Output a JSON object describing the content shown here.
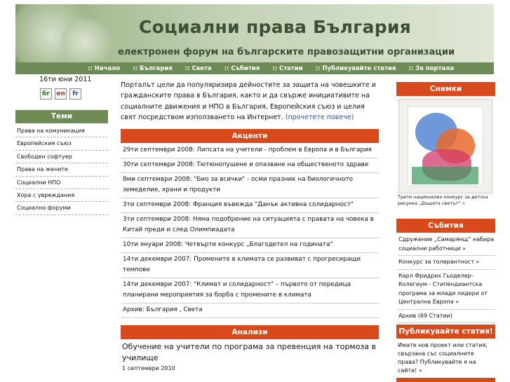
{
  "header": {
    "title": "Социални права България",
    "subtitle": "електронен форум на българските правозащитни организации"
  },
  "nav": [
    ":: Начало",
    ":: България",
    ":: Света",
    ":: Събития",
    ":: Статии",
    ":: Публикувайте статия",
    ":: За портала"
  ],
  "date": "16ти юни 2011",
  "languages": [
    "бг",
    "en",
    "fr"
  ],
  "topics": {
    "heading": "Теми",
    "items": [
      "Права на комуникация",
      "Европейския съюз",
      "Свободен софтуер",
      "Права на жените",
      "Социални НПО",
      "Хора с увреждания",
      "Социално форуми"
    ]
  },
  "intro": {
    "text": "Порталът цели да популяризира дейностите за защита на човешките и гражданските права в България, както и да свърже инициативите на социалните движения и НПО в България, Европейския съюз и целия свят посредством използването на Интернет.",
    "more": "(прочетете повече)"
  },
  "highlights": {
    "heading": "Акценти",
    "items": [
      "29ти септември 2008: Липсата на учители - проблем в Европа и в България",
      "30ти септември 2008: Тютюнопушене и опазване на общественото здраве",
      "8ми септември 2008: \"Био за всички\" - осми празник на биологичното земеделие, храни и продукти",
      "3ти септември 2008: Франция въвежда \"Данък активна солидарност\"",
      "3ти септември 2008: Няма подобрение на ситуацията с правата на човека в Китай преди и след Олимпиадата",
      "10ти януари 2008: Четвърти конкурс „Благодетел на годината“",
      "14ти декември 2007: Промените в климата се развиват с прогресиращи темпове",
      "14ти декември 2007: \"Климат и солидарност\" – първото от поредица планирани мероприятия за борба с промените в климата",
      "Архив: България , Света"
    ]
  },
  "analysis": {
    "heading": "Анализи",
    "title": "Обучение на учители по програма за превенция на тормоза в училище",
    "date": "1 септември 2010"
  },
  "photos": {
    "heading": "Снимки",
    "caption": "Трети национален конкурс за детска рисунка „Дъщата светът“ »"
  },
  "events": {
    "heading": "Събития",
    "items": [
      "Сдружение „Самарянщ“ набира социални работници »",
      "Конкурс за толерантност »",
      "Карл Фридрих Гьоделер-Колегиум - Стипендиантска програма за млади лидери от Централна Европа »",
      "Архив (69 Статии)"
    ]
  },
  "publish": {
    "heading": "Публикувайте статия!",
    "text": "Имате нов проект или статия, свързана със социалните права? Публикувайте я на сайта! »"
  }
}
